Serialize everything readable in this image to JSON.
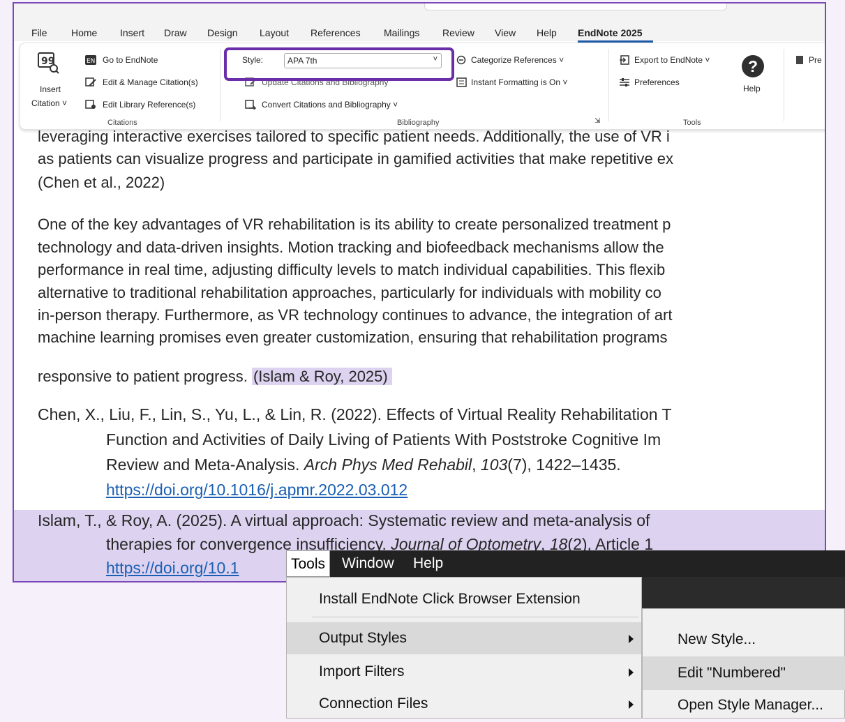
{
  "word": {
    "tabs": [
      "File",
      "Home",
      "Insert",
      "Draw",
      "Design",
      "Layout",
      "References",
      "Mailings",
      "Review",
      "View",
      "Help",
      "EndNote 2025"
    ],
    "ribbon": {
      "insert_citation": {
        "line1": "Insert",
        "line2": "Citation ˅"
      },
      "citations": {
        "go_to": "Go to EndNote",
        "edit_manage": "Edit & Manage Citation(s)",
        "edit_library": "Edit Library Reference(s)",
        "group_label": "Citations"
      },
      "bibliography": {
        "style_label": "Style:",
        "style_value": "APA 7th",
        "update": "Update Citations and Bibliography",
        "convert": "Convert Citations and Bibliography ˅",
        "group_label": "Bibliography"
      },
      "formatting": {
        "categorize": "Categorize References ˅",
        "instant": "Instant Formatting is On ˅"
      },
      "tools": {
        "export": "Export to EndNote ˅",
        "preferences": "Preferences",
        "help": "Help",
        "group_label": "Tools",
        "partial": "Pre"
      }
    },
    "document": {
      "p1": [
        "leveraging interactive exercises tailored to specific patient needs. Additionally, the use of VR i",
        "as patients can visualize progress and participate in gamified activities that make repetitive ex",
        "(Chen et al., 2022)"
      ],
      "p2": [
        "One of the key advantages of VR rehabilitation is its ability to create personalized treatment p",
        "technology and data-driven insights. Motion tracking and biofeedback mechanisms allow the",
        "performance in real time, adjusting difficulty levels to match individual capabilities. This flexib",
        "alternative to traditional rehabilitation approaches, particularly for individuals with mobility co",
        "in-person therapy. Furthermore, as VR technology continues to advance, the integration of art",
        "machine learning promises even greater customization, ensuring that rehabilitation programs"
      ],
      "p2_last": "responsive to patient progress. ",
      "p2_citation": "(Islam & Roy, 2025)",
      "ref1": {
        "line1": "Chen, X., Liu, F., Lin, S., Yu, L., & Lin, R. (2022). Effects of Virtual Reality Rehabilitation T",
        "line2": "Function and Activities of Daily Living of Patients With Poststroke Cognitive Im",
        "line3_a": "Review and Meta-Analysis. ",
        "line3_journal": "Arch Phys Med Rehabil",
        "line3_b": ", ",
        "line3_vol": "103",
        "line3_c": "(7), 1422–1435.",
        "doi": "https://doi.org/10.1016/j.apmr.2022.03.012"
      },
      "ref2": {
        "line1": "Islam, T., & Roy, A. (2025). A virtual approach: Systematic review and meta-analysis of",
        "line2_a": "therapies for convergence insufficiency. ",
        "line2_journal": "Journal of Optometry",
        "line2_b": ", ",
        "line2_vol": "18",
        "line2_c": "(2), Article 1",
        "doi": "https://doi.org/10.1"
      }
    }
  },
  "endnote": {
    "menubar": [
      "Tools",
      "Window",
      "Help"
    ],
    "tools_menu": [
      {
        "label": "Install EndNote Click Browser Extension",
        "submenu": false
      },
      {
        "label": "Output Styles",
        "submenu": true
      },
      {
        "label": "Import Filters",
        "submenu": true
      },
      {
        "label": "Connection Files",
        "submenu": true
      }
    ],
    "output_styles_submenu": [
      "New Style...",
      "Edit \"Numbered\"",
      "Open Style Manager..."
    ]
  },
  "colors": {
    "accent_purple": "#6a2fa8",
    "citation_highlight": "#ddd3f0",
    "link": "#1a5fb4"
  }
}
